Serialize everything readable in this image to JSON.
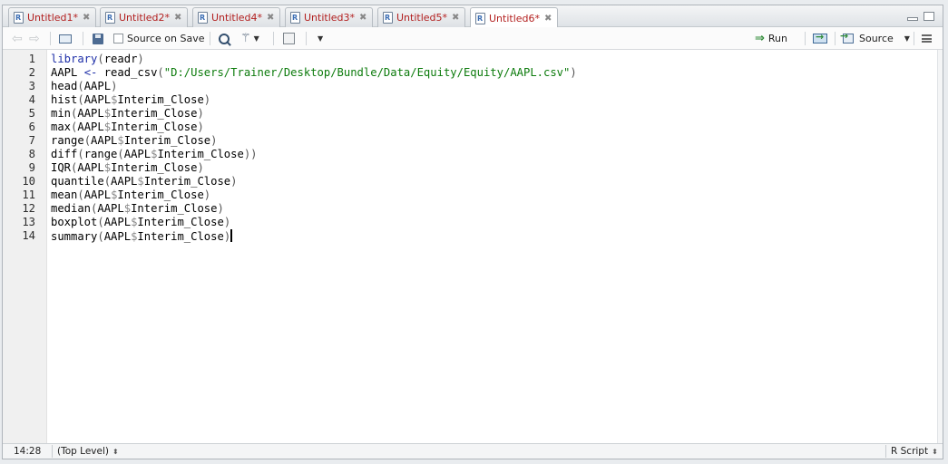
{
  "tabs": [
    {
      "label": "Untitled1*",
      "active": false
    },
    {
      "label": "Untitled2*",
      "active": false
    },
    {
      "label": "Untitled4*",
      "active": false
    },
    {
      "label": "Untitled3*",
      "active": false
    },
    {
      "label": "Untitled5*",
      "active": false
    },
    {
      "label": "Untitled6*",
      "active": true
    }
  ],
  "toolbar": {
    "source_on_save_label": "Source on Save",
    "source_on_save_checked": false,
    "run_label": "Run",
    "source_label": "Source"
  },
  "editor": {
    "lines": [
      {
        "num": "1",
        "code": "library(readr)"
      },
      {
        "num": "2",
        "code": "AAPL <- read_csv(\"D:/Users/Trainer/Desktop/Bundle/Data/Equity/Equity/AAPL.csv\")"
      },
      {
        "num": "3",
        "code": "head(AAPL)"
      },
      {
        "num": "4",
        "code": "hist(AAPL$Interim_Close)"
      },
      {
        "num": "5",
        "code": "min(AAPL$Interim_Close)"
      },
      {
        "num": "6",
        "code": "max(AAPL$Interim_Close)"
      },
      {
        "num": "7",
        "code": "range(AAPL$Interim_Close)"
      },
      {
        "num": "8",
        "code": "diff(range(AAPL$Interim_Close))"
      },
      {
        "num": "9",
        "code": "IQR(AAPL$Interim_Close)"
      },
      {
        "num": "10",
        "code": "quantile(AAPL$Interim_Close)"
      },
      {
        "num": "11",
        "code": "mean(AAPL$Interim_Close)"
      },
      {
        "num": "12",
        "code": "median(AAPL$Interim_Close)"
      },
      {
        "num": "13",
        "code": "boxplot(AAPL$Interim_Close)"
      },
      {
        "num": "14",
        "code": "summary(AAPL$Interim_Close)"
      }
    ]
  },
  "statusbar": {
    "cursor_position": "14:28",
    "scope": "(Top Level)",
    "file_type": "R Script"
  },
  "icons": {
    "back": "back-arrow-icon",
    "forward": "forward-arrow-icon",
    "show_in_window": "show-in-new-window-icon",
    "save": "save-icon",
    "search": "search-icon",
    "code_tools": "magic-wand-icon",
    "compile_report": "notebook-icon",
    "run": "run-arrow-icon",
    "rerun": "rerun-icon",
    "source": "source-icon",
    "outline": "outline-icon"
  },
  "colors": {
    "tab_label": "#b3201f",
    "string": "#0c7b0c",
    "operator": "#1e2fa8"
  }
}
